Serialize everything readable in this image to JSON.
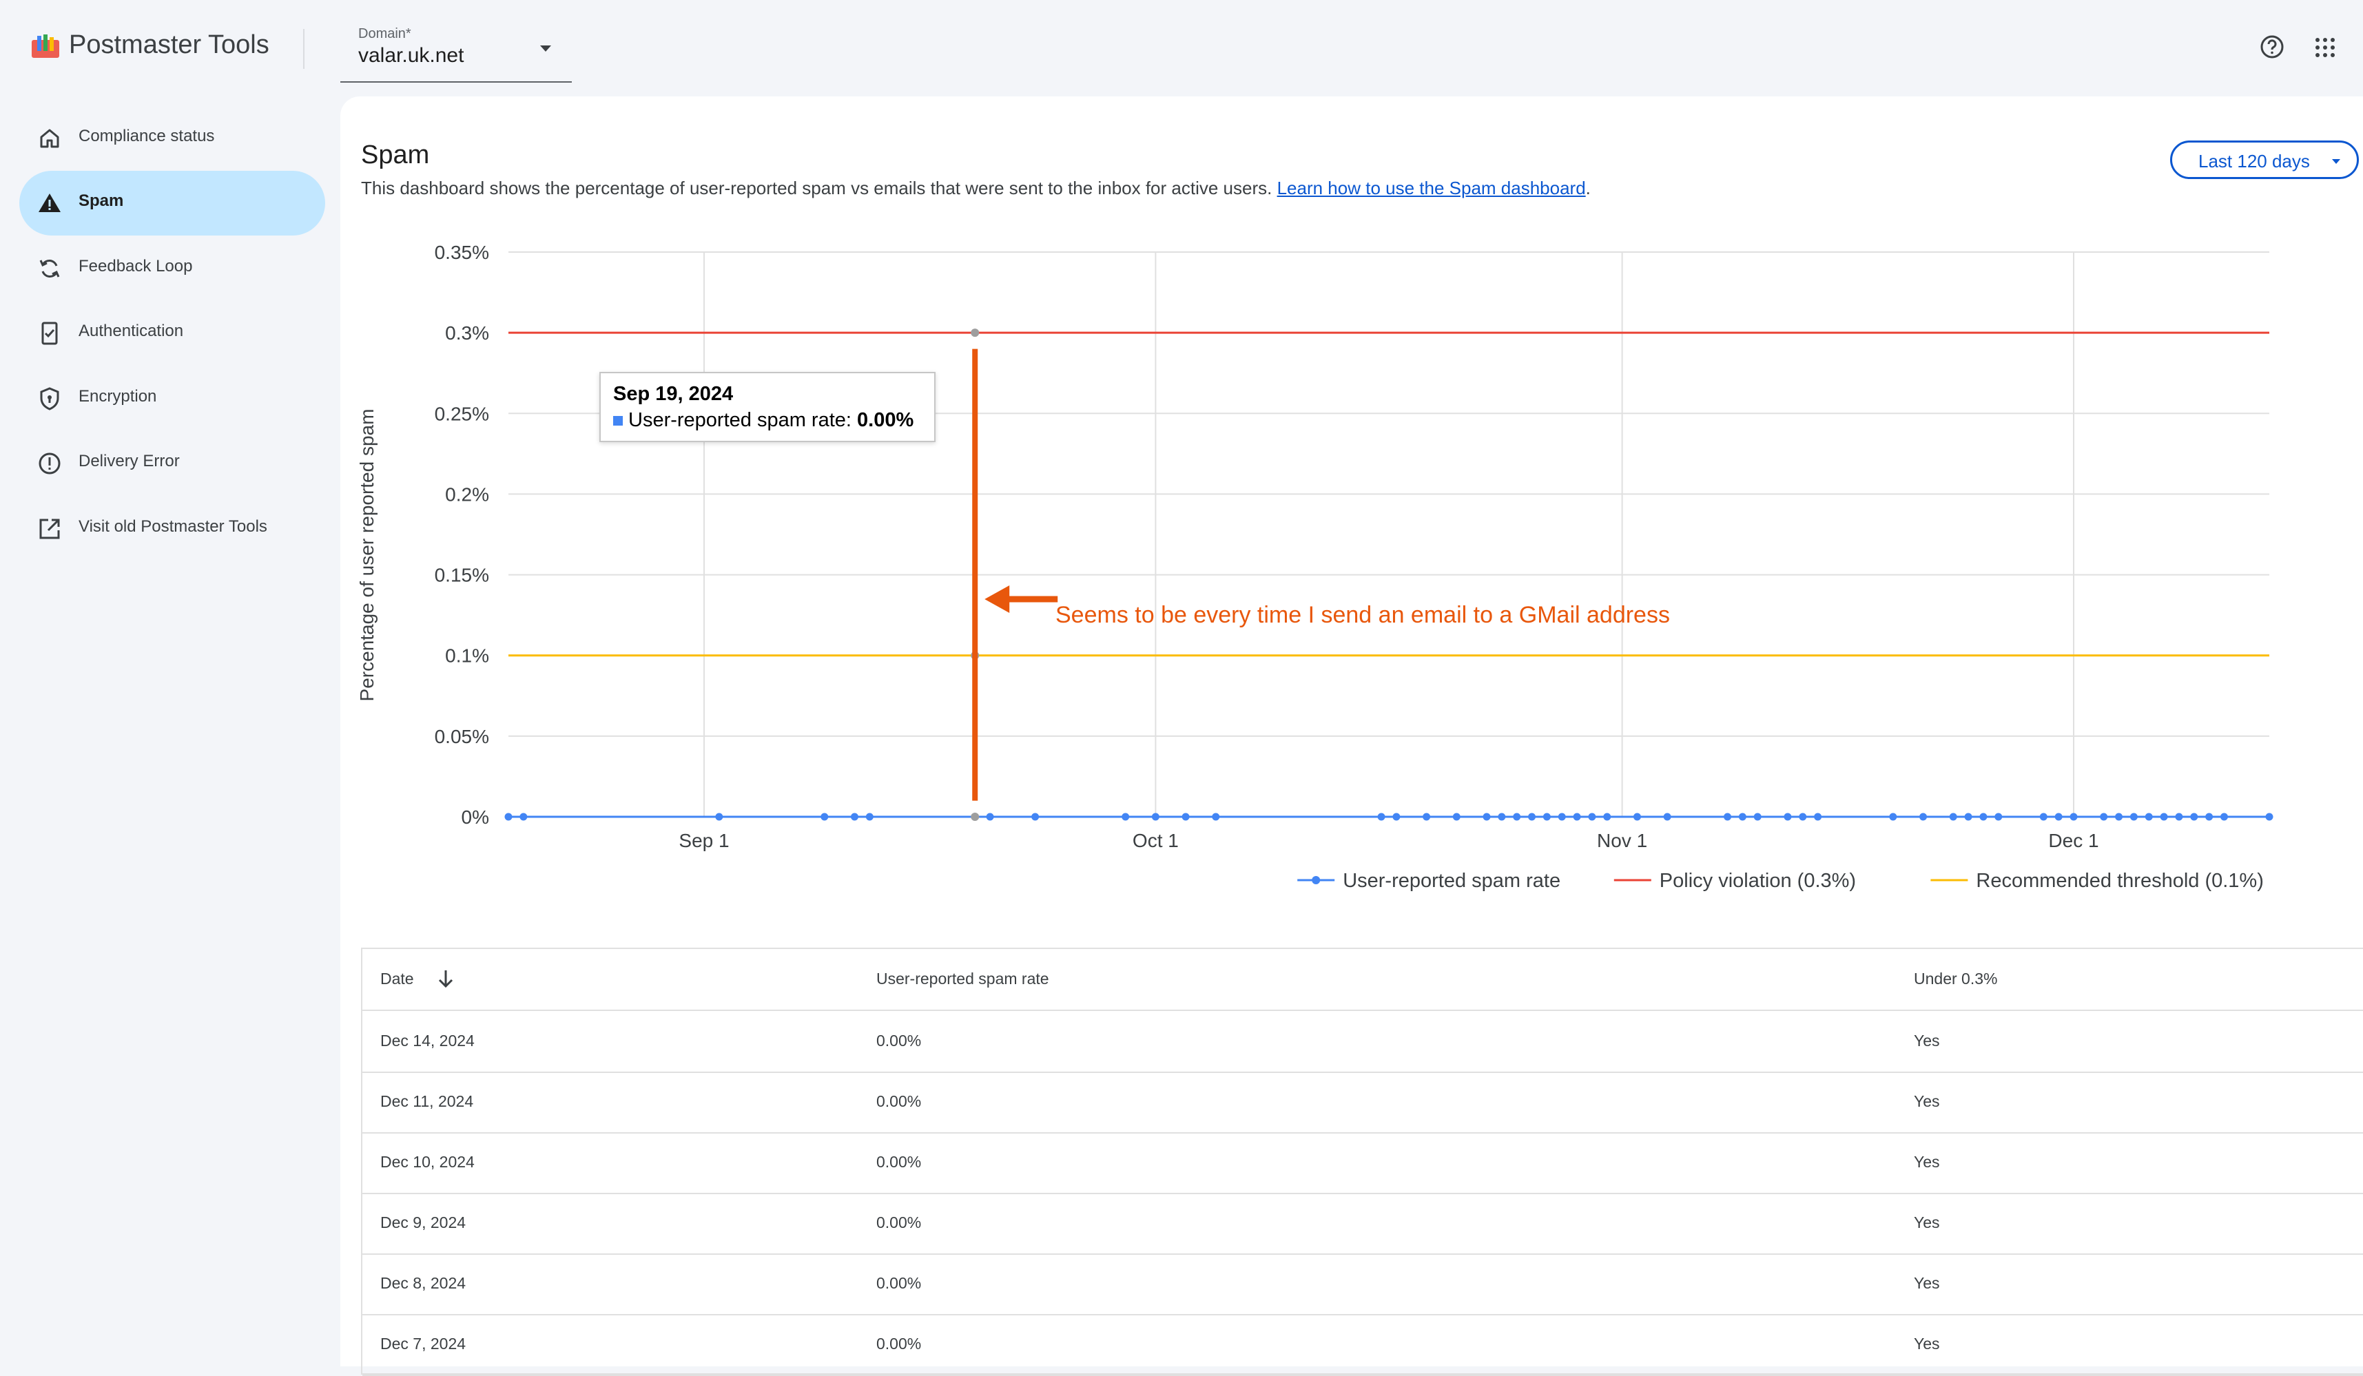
{
  "app": {
    "title": "Postmaster Tools"
  },
  "domain": {
    "label": "Domain*",
    "value": "valar.uk.net"
  },
  "header_icons": [
    "help-icon",
    "apps-grid-icon"
  ],
  "sidebar": {
    "items": [
      {
        "label": "Compliance status",
        "icon": "home-icon",
        "active": false
      },
      {
        "label": "Spam",
        "icon": "warning-icon",
        "active": true
      },
      {
        "label": "Feedback Loop",
        "icon": "loop-icon",
        "active": false
      },
      {
        "label": "Authentication",
        "icon": "verified-document-icon",
        "active": false
      },
      {
        "label": "Encryption",
        "icon": "shield-icon",
        "active": false
      },
      {
        "label": "Delivery Error",
        "icon": "error-icon",
        "active": false
      },
      {
        "label": "Visit old Postmaster Tools",
        "icon": "open-external-icon",
        "active": false
      }
    ]
  },
  "page": {
    "title": "Spam",
    "description": "This dashboard shows the percentage of user-reported spam vs emails that were sent to the inbox for active users.",
    "link": "Learn how to use the Spam dashboard",
    "link_suffix": ".",
    "range": "Last 120 days"
  },
  "chart_data": {
    "type": "line",
    "ylabel": "Percentage of user reported spam",
    "y_ticks": [
      "0%",
      "0.05%",
      "0.1%",
      "0.15%",
      "0.2%",
      "0.25%",
      "0.3%",
      "0.35%"
    ],
    "ylim": [
      0,
      0.35
    ],
    "x_ticks": [
      "Sep 1",
      "Oct 1",
      "Nov 1",
      "Dec 1"
    ],
    "x_range": [
      "Aug 19, 2024",
      "Dec 14, 2024"
    ],
    "series": [
      {
        "name": "User-reported spam rate",
        "color": "#4285f4",
        "points": [
          {
            "x": "Aug 19, 2024",
            "y": 0
          },
          {
            "x": "Aug 20, 2024",
            "y": 0
          },
          {
            "x": "Sep 2, 2024",
            "y": 0
          },
          {
            "x": "Sep 9, 2024",
            "y": 0
          },
          {
            "x": "Sep 11, 2024",
            "y": 0
          },
          {
            "x": "Sep 12, 2024",
            "y": 0
          },
          {
            "x": "Sep 19, 2024",
            "y": 0
          },
          {
            "x": "Sep 20, 2024",
            "y": 0
          },
          {
            "x": "Sep 23, 2024",
            "y": 0
          },
          {
            "x": "Sep 29, 2024",
            "y": 0
          },
          {
            "x": "Oct 1, 2024",
            "y": 0
          },
          {
            "x": "Oct 3, 2024",
            "y": 0
          },
          {
            "x": "Oct 5, 2024",
            "y": 0
          },
          {
            "x": "Oct 16, 2024",
            "y": 0
          },
          {
            "x": "Oct 17, 2024",
            "y": 0
          },
          {
            "x": "Oct 19, 2024",
            "y": 0
          },
          {
            "x": "Oct 21, 2024",
            "y": 0
          },
          {
            "x": "Oct 23, 2024",
            "y": 0
          },
          {
            "x": "Oct 24, 2024",
            "y": 0
          },
          {
            "x": "Oct 25, 2024",
            "y": 0
          },
          {
            "x": "Oct 26, 2024",
            "y": 0
          },
          {
            "x": "Oct 27, 2024",
            "y": 0
          },
          {
            "x": "Oct 28, 2024",
            "y": 0
          },
          {
            "x": "Oct 29, 2024",
            "y": 0
          },
          {
            "x": "Oct 30, 2024",
            "y": 0
          },
          {
            "x": "Oct 31, 2024",
            "y": 0
          },
          {
            "x": "Nov 2, 2024",
            "y": 0
          },
          {
            "x": "Nov 4, 2024",
            "y": 0
          },
          {
            "x": "Nov 8, 2024",
            "y": 0
          },
          {
            "x": "Nov 9, 2024",
            "y": 0
          },
          {
            "x": "Nov 10, 2024",
            "y": 0
          },
          {
            "x": "Nov 12, 2024",
            "y": 0
          },
          {
            "x": "Nov 13, 2024",
            "y": 0
          },
          {
            "x": "Nov 14, 2024",
            "y": 0
          },
          {
            "x": "Nov 19, 2024",
            "y": 0
          },
          {
            "x": "Nov 21, 2024",
            "y": 0
          },
          {
            "x": "Nov 23, 2024",
            "y": 0
          },
          {
            "x": "Nov 24, 2024",
            "y": 0
          },
          {
            "x": "Nov 25, 2024",
            "y": 0
          },
          {
            "x": "Nov 26, 2024",
            "y": 0
          },
          {
            "x": "Nov 29, 2024",
            "y": 0
          },
          {
            "x": "Nov 30, 2024",
            "y": 0
          },
          {
            "x": "Dec 1, 2024",
            "y": 0
          },
          {
            "x": "Dec 3, 2024",
            "y": 0
          },
          {
            "x": "Dec 4, 2024",
            "y": 0
          },
          {
            "x": "Dec 5, 2024",
            "y": 0
          },
          {
            "x": "Dec 6, 2024",
            "y": 0
          },
          {
            "x": "Dec 7, 2024",
            "y": 0
          },
          {
            "x": "Dec 8, 2024",
            "y": 0
          },
          {
            "x": "Dec 9, 2024",
            "y": 0
          },
          {
            "x": "Dec 10, 2024",
            "y": 0
          },
          {
            "x": "Dec 11, 2024",
            "y": 0
          },
          {
            "x": "Dec 14, 2024",
            "y": 0
          }
        ]
      },
      {
        "name": "Policy violation (0.3%)",
        "color": "#ea4335",
        "constant": 0.3
      },
      {
        "name": "Recommended threshold (0.1%)",
        "color": "#fbbc04",
        "constant": 0.1
      }
    ],
    "grid": true,
    "legend": "bottom-right",
    "tooltip": {
      "date": "Sep 19, 2024",
      "label": "User-reported spam rate:",
      "value": "0.00%"
    },
    "annotation": {
      "text": "Seems to be every time I send an email to a GMail address",
      "color": "#e8570c",
      "marker_date": "Sep 19, 2024"
    }
  },
  "table": {
    "columns": [
      "Date",
      "User-reported spam rate",
      "Under 0.3%"
    ],
    "sort_icon": "arrow-down-icon",
    "rows": [
      [
        "Dec 14, 2024",
        "0.00%",
        "Yes"
      ],
      [
        "Dec 11, 2024",
        "0.00%",
        "Yes"
      ],
      [
        "Dec 10, 2024",
        "0.00%",
        "Yes"
      ],
      [
        "Dec 9, 2024",
        "0.00%",
        "Yes"
      ],
      [
        "Dec 8, 2024",
        "0.00%",
        "Yes"
      ],
      [
        "Dec 7, 2024",
        "0.00%",
        "Yes"
      ]
    ]
  }
}
